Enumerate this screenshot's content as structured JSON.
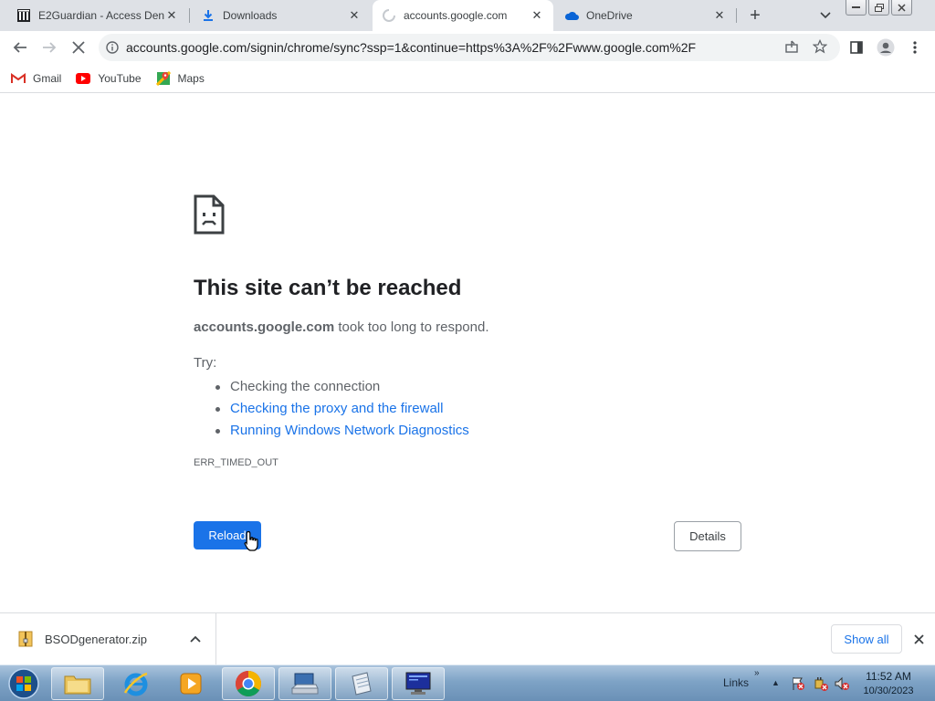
{
  "tabs": [
    {
      "title": "E2Guardian - Access Deni",
      "icon": "building-icon"
    },
    {
      "title": "Downloads",
      "icon": "download-icon"
    },
    {
      "title": "accounts.google.com",
      "icon": "loading-spinner-icon",
      "active": true
    },
    {
      "title": "OneDrive",
      "icon": "onedrive-cloud-icon"
    }
  ],
  "toolbar": {
    "url": "accounts.google.com/signin/chrome/sync?ssp=1&continue=https%3A%2F%2Fwww.google.com%2F"
  },
  "bookmarks": [
    {
      "label": "Gmail",
      "icon": "gmail-icon"
    },
    {
      "label": "YouTube",
      "icon": "youtube-icon"
    },
    {
      "label": "Maps",
      "icon": "maps-icon"
    }
  ],
  "error": {
    "title": "This site can’t be reached",
    "host": "accounts.google.com",
    "description_suffix": " took too long to respond.",
    "try_label": "Try:",
    "suggestions": [
      "Checking the connection",
      "Checking the proxy and the firewall",
      "Running Windows Network Diagnostics"
    ],
    "code": "ERR_TIMED_OUT",
    "reload_label": "Reload",
    "details_label": "Details"
  },
  "downloads": {
    "filename": "BSODgenerator.zip",
    "show_all_label": "Show all"
  },
  "taskbar": {
    "links_label": "Links",
    "time": "11:52 AM",
    "date": "10/30/2023"
  },
  "colors": {
    "accent": "#1a73e8",
    "tabstrip": "#dee1e6"
  }
}
